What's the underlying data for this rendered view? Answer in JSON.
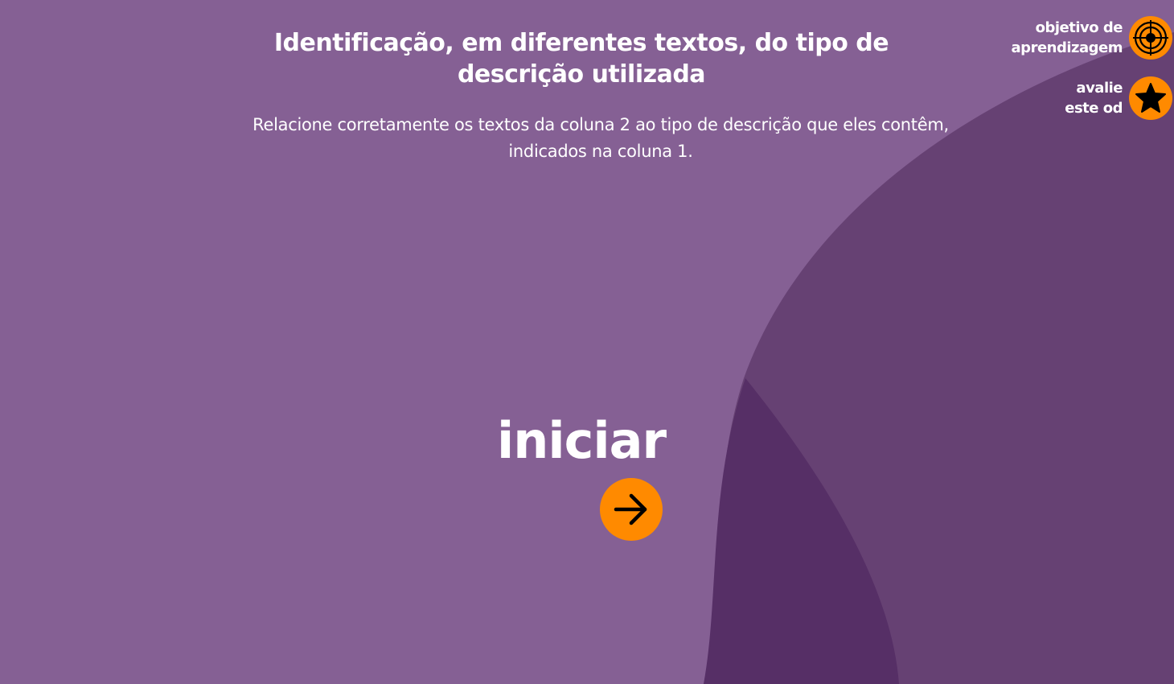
{
  "theme": {
    "background": "#856094",
    "mid_shape": "#664173",
    "dark_shape": "#562f66",
    "accent": "#ff8a00",
    "text": "#ffffff"
  },
  "header": {
    "title": "Identificação, em diferentes textos, do tipo de descrição utilizada",
    "subtitle": "Relacione corretamente os textos da coluna 2 ao tipo de descrição que eles contêm, indicados na coluna 1."
  },
  "side_menu": {
    "objective_label_line1": "objetivo de",
    "objective_label_line2": "aprendizagem",
    "objective_icon": "target-icon",
    "rate_label_line1": "avalie",
    "rate_label_line2": "este od",
    "rate_icon": "star-icon"
  },
  "start": {
    "label": "iniciar",
    "icon": "arrow-right-icon"
  }
}
